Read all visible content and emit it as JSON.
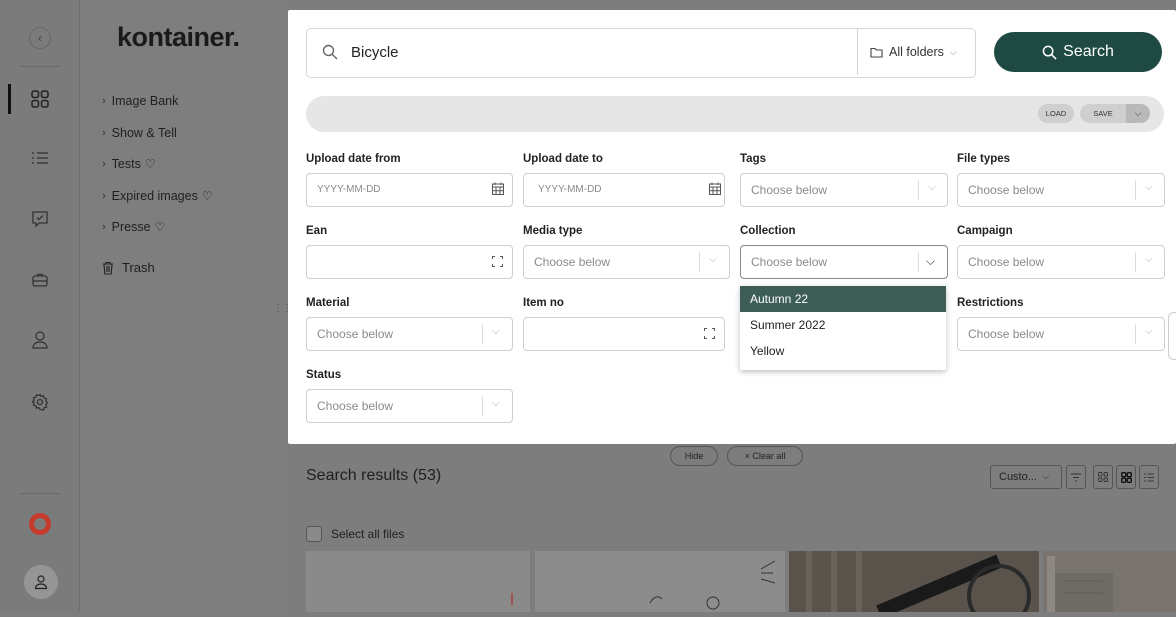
{
  "brand": {
    "logo_text": "kontainer."
  },
  "rail": {
    "icons": [
      "collapse-icon",
      "dashboard-grid-icon",
      "list-icon",
      "approval-icon",
      "briefcase-icon",
      "user-icon",
      "gear-icon",
      "help-lifebuoy-icon",
      "avatar-icon"
    ]
  },
  "folders": {
    "items": [
      {
        "label": "Image Bank",
        "fav": false
      },
      {
        "label": "Show & Tell",
        "fav": false
      },
      {
        "label": "Tests",
        "fav": true
      },
      {
        "label": "Expired images",
        "fav": true
      },
      {
        "label": "Presse",
        "fav": true
      }
    ],
    "trash_label": "Trash"
  },
  "search": {
    "query": "Bicycle",
    "folder_scope": "All folders",
    "button_label": "Search"
  },
  "saved_filters": {
    "load_label": "LOAD",
    "save_label": "SAVE"
  },
  "filters": {
    "upload_from": {
      "label": "Upload date from",
      "placeholder": "YYYY-MM-DD"
    },
    "upload_to": {
      "label": "Upload date to",
      "placeholder": "YYYY-MM-DD"
    },
    "tags": {
      "label": "Tags",
      "placeholder": "Choose below"
    },
    "file_types": {
      "label": "File types",
      "placeholder": "Choose below"
    },
    "ean": {
      "label": "Ean",
      "placeholder": ""
    },
    "media_type": {
      "label": "Media type",
      "placeholder": "Choose below"
    },
    "collection": {
      "label": "Collection",
      "placeholder": "Choose below"
    },
    "campaign": {
      "label": "Campaign",
      "placeholder": "Choose below"
    },
    "material": {
      "label": "Material",
      "placeholder": "Choose below"
    },
    "item_no": {
      "label": "Item no",
      "placeholder": ""
    },
    "restrictions": {
      "label": "Restrictions",
      "placeholder": "Choose below"
    },
    "status": {
      "label": "Status",
      "placeholder": "Choose below"
    }
  },
  "collection_options": [
    "Autumn 22",
    "Summer 2022",
    "Yellow"
  ],
  "collection_highlighted": "Autumn 22",
  "controls": {
    "hide_label": "Hide",
    "clear_label": "× Clear all"
  },
  "results": {
    "title": "Search results (53)",
    "sort_label": "Custo...",
    "select_all_label": "Select all files"
  },
  "colors": {
    "primary": "#1f4a44",
    "dropdown_selected": "#3d5d57",
    "overlay": "#7d7d7d",
    "help_red": "#c63b2c"
  }
}
